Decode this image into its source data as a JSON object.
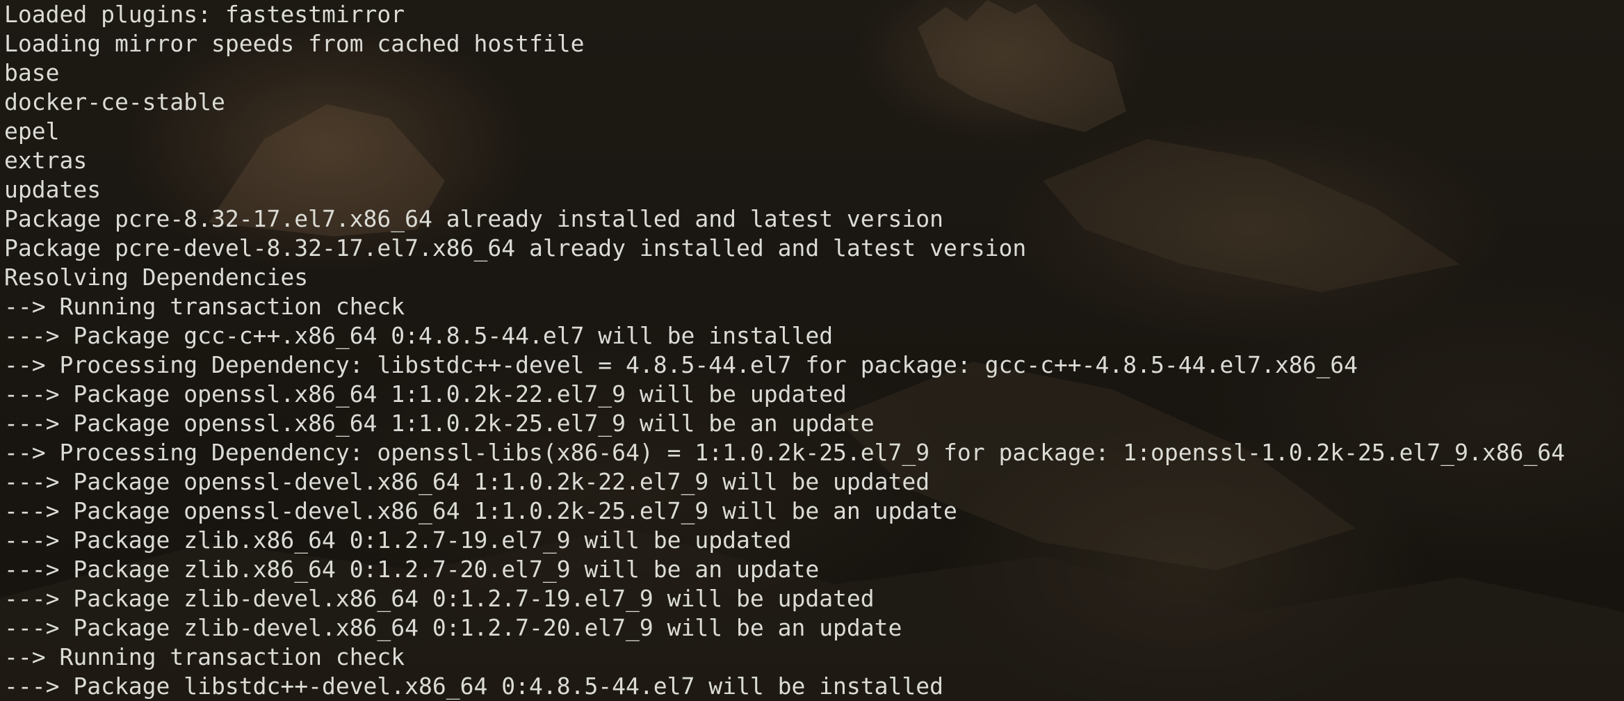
{
  "terminal": {
    "lines": [
      "Loaded plugins: fastestmirror",
      "Loading mirror speeds from cached hostfile",
      "base",
      "docker-ce-stable",
      "epel",
      "extras",
      "updates",
      "Package pcre-8.32-17.el7.x86_64 already installed and latest version",
      "Package pcre-devel-8.32-17.el7.x86_64 already installed and latest version",
      "Resolving Dependencies",
      "--> Running transaction check",
      "---> Package gcc-c++.x86_64 0:4.8.5-44.el7 will be installed",
      "--> Processing Dependency: libstdc++-devel = 4.8.5-44.el7 for package: gcc-c++-4.8.5-44.el7.x86_64",
      "---> Package openssl.x86_64 1:1.0.2k-22.el7_9 will be updated",
      "---> Package openssl.x86_64 1:1.0.2k-25.el7_9 will be an update",
      "--> Processing Dependency: openssl-libs(x86-64) = 1:1.0.2k-25.el7_9 for package: 1:openssl-1.0.2k-25.el7_9.x86_64",
      "---> Package openssl-devel.x86_64 1:1.0.2k-22.el7_9 will be updated",
      "---> Package openssl-devel.x86_64 1:1.0.2k-25.el7_9 will be an update",
      "---> Package zlib.x86_64 0:1.2.7-19.el7_9 will be updated",
      "---> Package zlib.x86_64 0:1.2.7-20.el7_9 will be an update",
      "---> Package zlib-devel.x86_64 0:1.2.7-19.el7_9 will be updated",
      "---> Package zlib-devel.x86_64 0:1.2.7-20.el7_9 will be an update",
      "--> Running transaction check",
      "---> Package libstdc++-devel.x86_64 0:4.8.5-44.el7 will be installed"
    ],
    "colors": {
      "text": "#dcdcd6",
      "background": "#17140f"
    }
  }
}
